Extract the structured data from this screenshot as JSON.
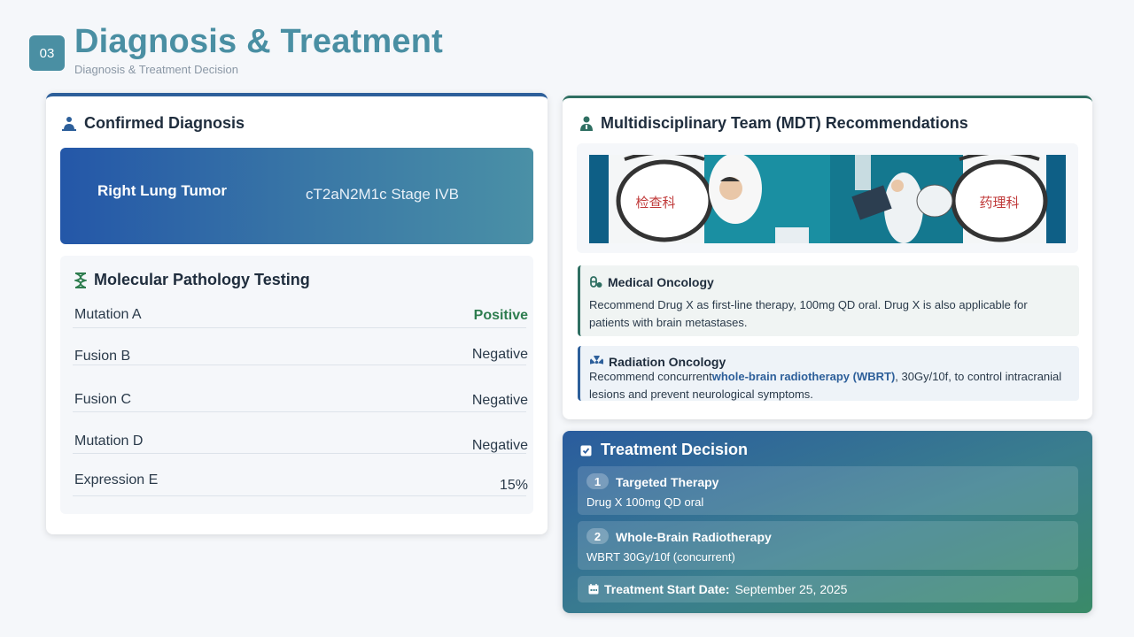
{
  "header": {
    "section_number": "03",
    "title": "Diagnosis & Treatment",
    "subtitle": "Diagnosis & Treatment Decision"
  },
  "diagnosis": {
    "title": "Confirmed Diagnosis",
    "name": "Right Lung Tumor",
    "stage": "cT2aN2M1c Stage IVB"
  },
  "pathology": {
    "title": "Molecular Pathology Testing",
    "rows": [
      {
        "label": "Mutation A",
        "value": "Positive"
      },
      {
        "label": "Fusion B",
        "value": "Negative"
      },
      {
        "label": "Fusion C",
        "value": "Negative"
      },
      {
        "label": "Mutation D",
        "value": "Negative"
      },
      {
        "label": "Expression E",
        "value": "15%"
      }
    ]
  },
  "mdt": {
    "title": "Multidisciplinary Team (MDT) Recommendations",
    "image_labels": [
      "检查科",
      "药理科"
    ],
    "medical": {
      "title": "Medical Oncology",
      "text": "Recommend Drug X as first-line therapy, 100mg QD oral. Drug X is also applicable for patients with brain metastases."
    },
    "radiation": {
      "title": "Radiation Oncology",
      "text_before": "Recommend concurrent",
      "highlight": "whole-brain radiotherapy (WBRT)",
      "text_after": ", 30Gy/10f, to control intracranial lesions and prevent neurological symptoms."
    }
  },
  "treatment": {
    "title": "Treatment Decision",
    "items": [
      {
        "number": "1",
        "title": "Targeted Therapy",
        "text": "Drug X 100mg QD oral"
      },
      {
        "number": "2",
        "title": "Whole-Brain Radiotherapy",
        "text": "WBRT 30Gy/10f (concurrent)"
      }
    ],
    "start_label": "Treatment Start Date:",
    "start_date": "September 25, 2025"
  },
  "colors": {
    "accent": "#4a8fa3",
    "positive": "#2e7d4f",
    "blue": "#2d5f9a",
    "green": "#2f6f62"
  }
}
